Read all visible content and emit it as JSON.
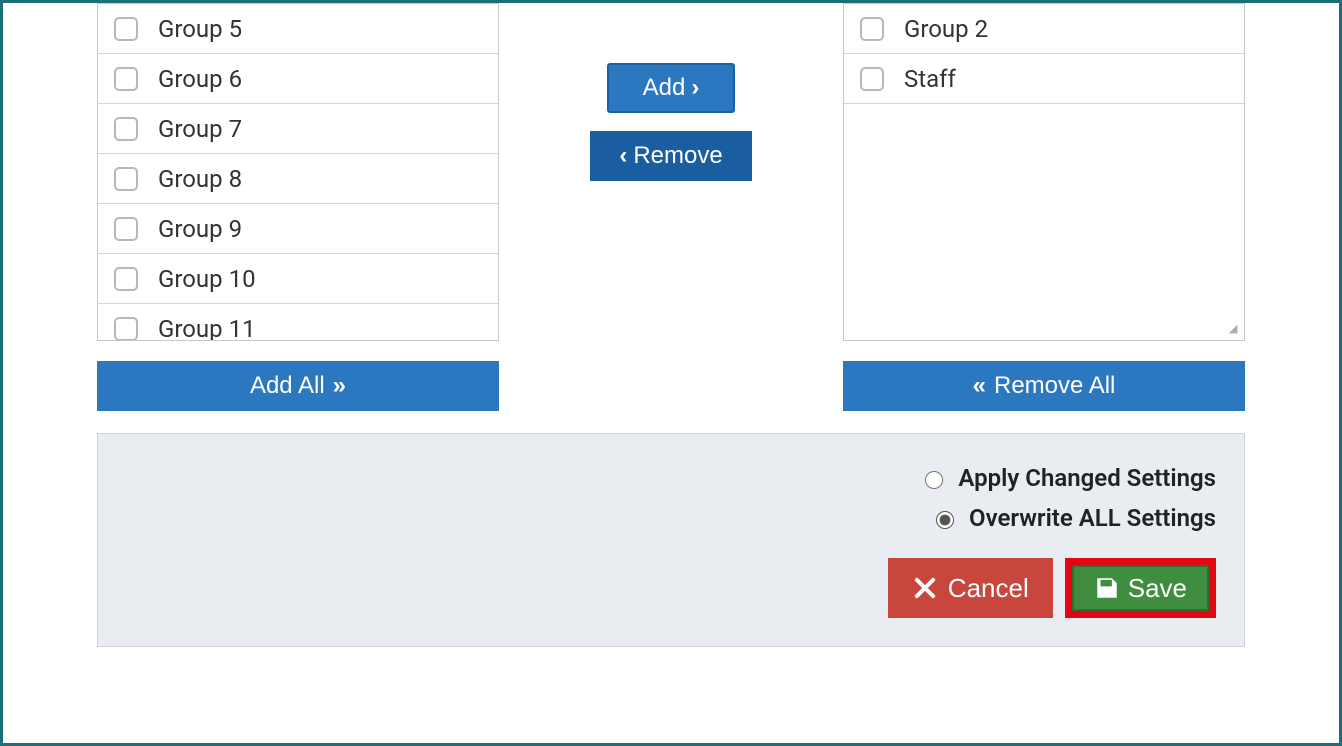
{
  "leftList": {
    "items": [
      {
        "label": "Group 5"
      },
      {
        "label": "Group 6"
      },
      {
        "label": "Group 7"
      },
      {
        "label": "Group 8"
      },
      {
        "label": "Group 9"
      },
      {
        "label": "Group 10"
      },
      {
        "label": "Group 11"
      }
    ],
    "addAll": "Add All"
  },
  "rightList": {
    "items": [
      {
        "label": "Group 2"
      },
      {
        "label": "Staff"
      }
    ],
    "removeAll": "Remove All"
  },
  "centerButtons": {
    "add": "Add",
    "remove": "Remove"
  },
  "footer": {
    "applyChanged": "Apply Changed Settings",
    "overwriteAll": "Overwrite ALL Settings",
    "selected": "overwrite",
    "cancel": "Cancel",
    "save": "Save"
  },
  "colors": {
    "frame": "#1b6e7a",
    "primaryBtn": "#2b77c0",
    "primaryBtnDark": "#1a5da0",
    "danger": "#c9463d",
    "success": "#3f8d3f",
    "highlight": "#e30613",
    "footerBg": "#e9edf1"
  }
}
